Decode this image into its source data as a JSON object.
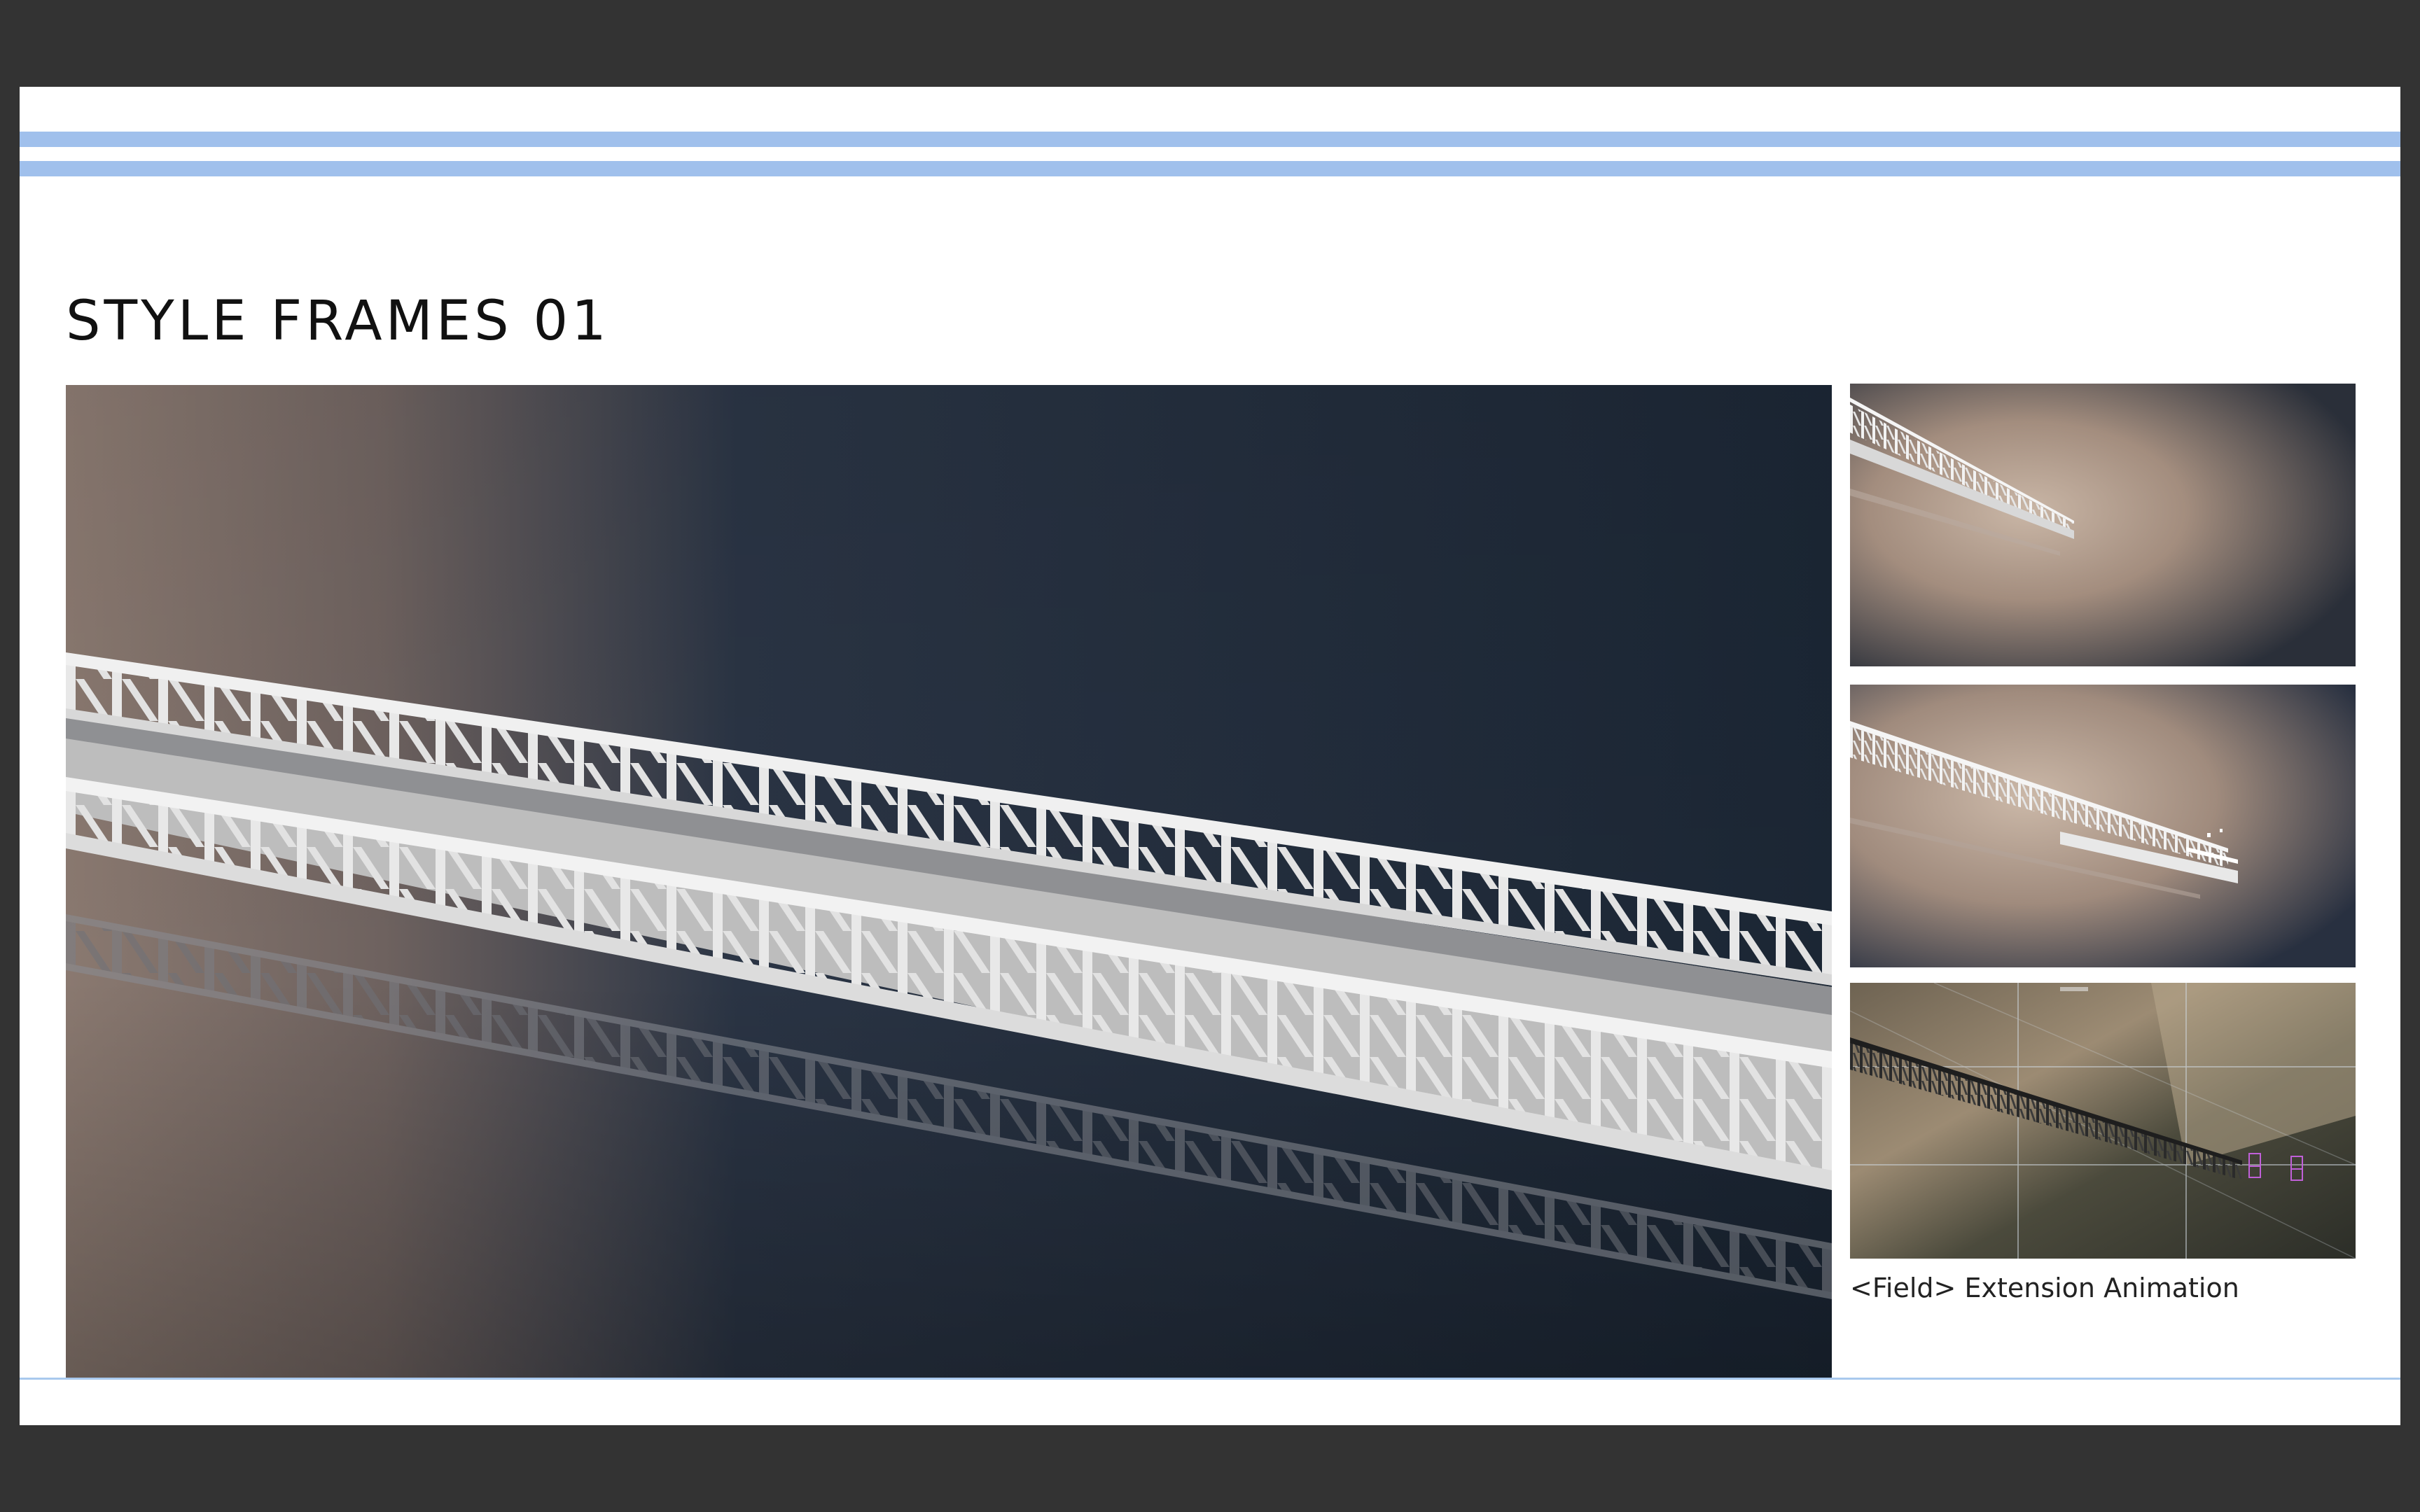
{
  "page": {
    "title": "STYLE FRAMES 01",
    "caption": "<Field> Extension Animation"
  },
  "frames": {
    "main": {
      "subject": "white truss bridge over dark water with reflection"
    },
    "thumbnails": [
      {
        "subject": "bridge truss against beige haze"
      },
      {
        "subject": "bridge truss extending with debris"
      },
      {
        "subject": "wireframe viewport of bridge over rocky terrain"
      }
    ]
  },
  "colors": {
    "background": "#333333",
    "slide": "#ffffff",
    "accent_rule": "#a0c0ec",
    "water_dark": "#1b2634",
    "haze_beige": "#a38d7e",
    "truss_white": "#e6e6e6"
  }
}
